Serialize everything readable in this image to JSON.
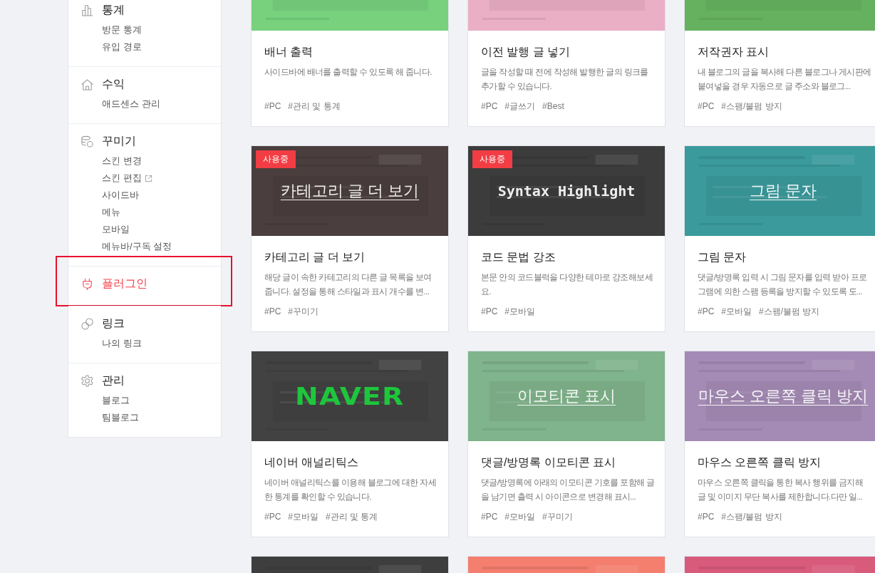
{
  "sidebar": {
    "sections": [
      {
        "title": "통계",
        "selected": false,
        "items": [
          {
            "label": "방문 통계"
          },
          {
            "label": "유입 경로"
          }
        ]
      },
      {
        "title": "수익",
        "selected": false,
        "items": [
          {
            "label": "애드센스 관리"
          }
        ]
      },
      {
        "title": "꾸미기",
        "selected": false,
        "items": [
          {
            "label": "스킨 변경"
          },
          {
            "label": "스킨 편집",
            "external": true
          },
          {
            "label": "사이드바"
          },
          {
            "label": "메뉴"
          },
          {
            "label": "모바일"
          },
          {
            "label": "메뉴바/구독 설정"
          }
        ]
      },
      {
        "title": "플러그인",
        "selected": true,
        "annotated": true
      },
      {
        "title": "링크",
        "selected": false,
        "items": [
          {
            "label": "나의 링크"
          }
        ]
      },
      {
        "title": "관리",
        "selected": false,
        "items": [
          {
            "label": "블로그"
          },
          {
            "label": "팀블로그"
          }
        ]
      }
    ]
  },
  "plugins": [
    {
      "color": "#77d17d",
      "title": "배너 출력",
      "description": "사이드바에 배너를 출력할 수 있도록 해 줍니다.",
      "tags": [
        "#PC",
        "#관리 및 통계"
      ]
    },
    {
      "color": "#eaaec5",
      "title": "이전 발행 글 넣기",
      "description": "글을 작성할 때 전에 작성해 발행한 글의 링크를 추가할 수 있습니다.",
      "tags": [
        "#PC",
        "#글쓰기",
        "#Best"
      ]
    },
    {
      "color": "#66b15f",
      "title": "저작권자 표시",
      "description": "내 블로그의 글을 복사해 다른 블로그나 게시판에 붙여넣을 경우 자동으로 글 주소와 블로그...",
      "tags": [
        "#PC",
        "#스팸/불펌 방지"
      ]
    },
    {
      "color": "#4a3e3e",
      "badge": "사용중",
      "banner": {
        "kind": "title",
        "text": "카테고리 글 더 보기"
      },
      "title": "카테고리 글 더 보기",
      "description": "해당 글이 속한 카테고리의 다른 글 목록을 보여줍니다. 설정을 통해 스타일과 표시 개수를 변...",
      "tags": [
        "#PC",
        "#꾸미기"
      ]
    },
    {
      "color": "#3c3c3c",
      "badge": "사용중",
      "banner": {
        "kind": "code",
        "text": "Syntax Highlight"
      },
      "title": "코드 문법 강조",
      "description": "본문 안의 코드블럭을 다양한 테마로 강조해보세요.",
      "tags": [
        "#PC",
        "#모바일"
      ]
    },
    {
      "color": "#3a9a9c",
      "banner": {
        "kind": "title",
        "text": "그림 문자"
      },
      "title": "그림 문자",
      "description": "댓글/방명록 입력 시 그림 문자를 입력 받아 프로그램에 의한 스팸 등록을 방지할 수 있도록 도...",
      "tags": [
        "#PC",
        "#모바일",
        "#스팸/불펌 방지"
      ]
    },
    {
      "color": "#424242",
      "banner": {
        "kind": "logo",
        "text": "NAVER"
      },
      "title": "네이버 애널리틱스",
      "description": "네이버 애널리틱스를 이용해 블로그에 대한 자세한 통계를 확인할 수 있습니다.",
      "tags": [
        "#PC",
        "#모바일",
        "#관리 및 통계"
      ]
    },
    {
      "color": "#80b48c",
      "banner": {
        "kind": "title",
        "text": "이모티콘 표시"
      },
      "title": "댓글/방명록 이모티콘 표시",
      "description": "댓글/방명록에 아래의 이모티콘 기호를 포함해 글을 남기면 출력 시 아이콘으로 변경해 표시...",
      "tags": [
        "#PC",
        "#모바일",
        "#꾸미기"
      ]
    },
    {
      "color": "#a48bb5",
      "banner": {
        "kind": "title",
        "text": "마우스 오른쪽 클릭 방지"
      },
      "title": "마우스 오른쪽 클릭 방지",
      "description": "마우스 오른쪽 클릭을 통한 복사 행위를 금지해 글 및 이미지 무단 복사를 제한합니다.다만 일...",
      "tags": [
        "#PC",
        "#스팸/불펌 방지"
      ]
    },
    {
      "color": "#3e3e3e"
    },
    {
      "color": "#f47f6f"
    },
    {
      "color": "#d85b7c"
    }
  ]
}
